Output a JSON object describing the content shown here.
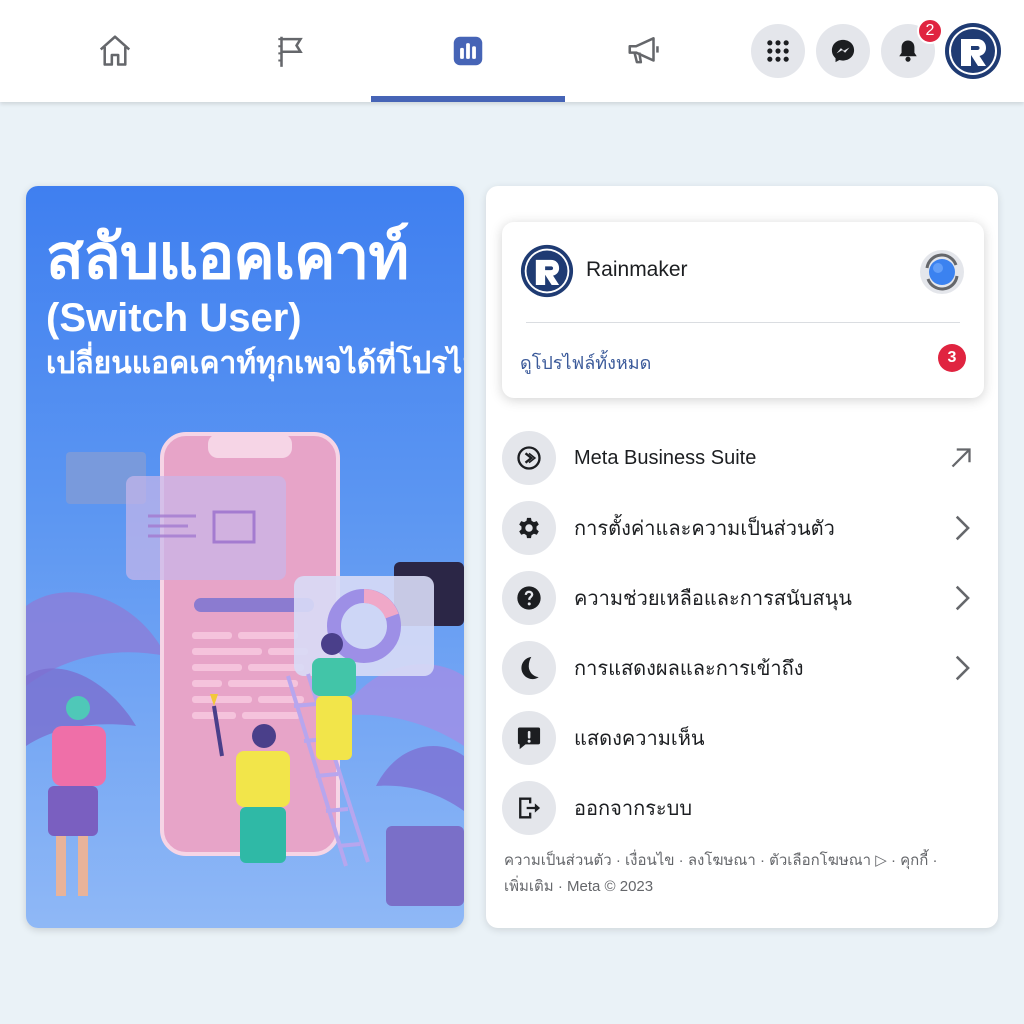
{
  "colors": {
    "accent": "#4664b6",
    "badge": "#e02440",
    "promo_blue": "#3f7ff0",
    "link": "#3b5a9a"
  },
  "topbar": {
    "tabs": [
      {
        "name": "home",
        "icon": "home-icon",
        "active": false
      },
      {
        "name": "pages",
        "icon": "flag-icon",
        "active": false
      },
      {
        "name": "dashboard",
        "icon": "bar-chart-icon",
        "active": true
      },
      {
        "name": "ads",
        "icon": "megaphone-icon",
        "active": false
      }
    ],
    "actions": [
      {
        "name": "menu",
        "icon": "grid-menu-icon"
      },
      {
        "name": "messenger",
        "icon": "messenger-icon"
      },
      {
        "name": "notifications",
        "icon": "bell-icon",
        "badge": "2"
      }
    ],
    "account_icon": "rainmaker-logo"
  },
  "promo": {
    "title": "สลับแอคเคาท์",
    "subtitle": "(Switch User)",
    "tagline": "เปลี่ยนแอคเคาท์ทุกเพจได้ที่โปรไฟล์"
  },
  "profile": {
    "name": "Rainmaker",
    "see_all": "ดูโปรไฟล์ทั้งหมด",
    "see_all_count": "3"
  },
  "menu": {
    "items": [
      {
        "label": "Meta Business Suite",
        "icon": "meta-business-suite-icon",
        "trail": "external-arrow-icon"
      },
      {
        "label": "การตั้งค่าและความเป็นส่วนตัว",
        "icon": "gear-icon",
        "trail": "chevron-right-icon"
      },
      {
        "label": "ความช่วยเหลือและการสนับสนุน",
        "icon": "help-icon",
        "trail": "chevron-right-icon"
      },
      {
        "label": "การแสดงผลและการเข้าถึง",
        "icon": "moon-icon",
        "trail": "chevron-right-icon"
      },
      {
        "label": "แสดงความเห็น",
        "icon": "feedback-icon",
        "trail": ""
      },
      {
        "label": "ออกจากระบบ",
        "icon": "logout-icon",
        "trail": ""
      }
    ]
  },
  "footer": {
    "line1": "ความเป็นส่วนตัว · เงื่อนไข · ลงโฆษณา · ตัวเลือกโฆษณา ▷ · คุกกี้ ·",
    "line2": "เพิ่มเติม · Meta © 2023"
  }
}
